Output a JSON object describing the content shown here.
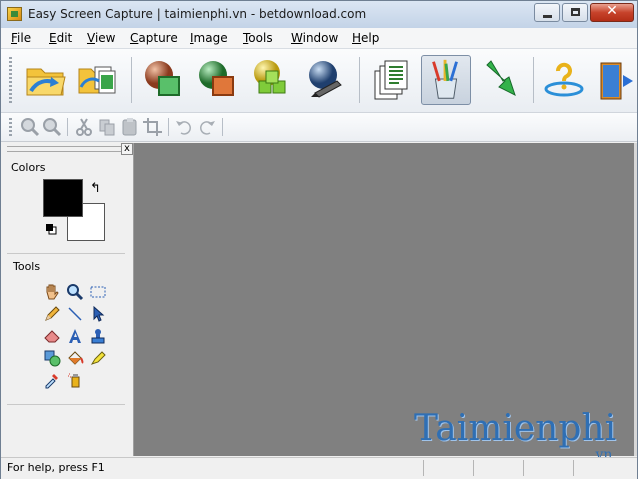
{
  "window": {
    "title": "Easy Screen Capture  | taimienphi.vn - betdownload.com",
    "close_symbol": "✕"
  },
  "menu": {
    "items": [
      {
        "first": "F",
        "rest": "ile"
      },
      {
        "first": "E",
        "rest": "dit"
      },
      {
        "first": "V",
        "rest": "iew"
      },
      {
        "first": "C",
        "rest": "apture"
      },
      {
        "first": "I",
        "rest": "mage"
      },
      {
        "first": "T",
        "rest": "ools"
      },
      {
        "first": "W",
        "rest": "indow"
      },
      {
        "first": "H",
        "rest": "elp"
      }
    ]
  },
  "panel": {
    "close_symbol": "x",
    "colors_label": "Colors",
    "tools_label": "Tools",
    "swap_symbol": "↰",
    "foreground_color": "#000000",
    "background_color": "#ffffff"
  },
  "watermark": {
    "main": "Taimienphi",
    "sub": ".vn"
  },
  "status": {
    "text": "For help, press F1"
  },
  "colors": {
    "canvas": "#808080",
    "title_bar": "#c3d3e7",
    "close_button": "#c7432b"
  }
}
